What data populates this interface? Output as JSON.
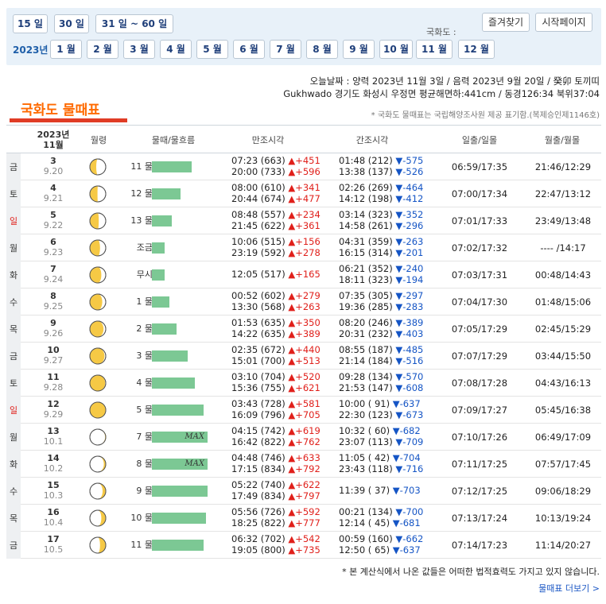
{
  "top_row_buttons": [
    "15 일",
    "30 일",
    "31 일 ~ 60 일"
  ],
  "kw_label": "국화도 :",
  "bookmark_btn": "즐겨찾기",
  "homepage_btn": "시작페이지",
  "year_label": "2023년",
  "months": [
    "1 월",
    "2 월",
    "3 월",
    "4 월",
    "5 월",
    "6 월",
    "7 월",
    "8 월",
    "9 월",
    "10 월",
    "11 월",
    "12 월"
  ],
  "today_line1": "오늘날짜 : 양력 2023년 11월 3일 / 음력 2023년 9월 20일 / 癸卯 토끼띠",
  "today_line2": "Gukhwado 경기도 화성시 우정면 평균해면하:441cm / 동경126:34 북위37:04",
  "page_title": "국화도 물때표",
  "source_note": "* 국화도 물때표는 국립해양조사원 제공 표기함.(복제승인제1146호)",
  "header": {
    "date_year": "2023년",
    "date_month": "11월",
    "moon": "월령",
    "tide": "물때/물흐름",
    "high": "만조시각",
    "low": "간조시각",
    "sun": "일출/일몰",
    "moonrise": "월출/월몰"
  },
  "rows": [
    {
      "wd": "금",
      "date": "3",
      "lunar": "9.20",
      "tide": "11 물",
      "bar": 0.56,
      "max": "",
      "high1": "07:23 (663)",
      "hd1": "▲+451",
      "high2": "20:00 (733)",
      "hd2": "▲+596",
      "low1": "01:48 (212)",
      "ld1": "▼-575",
      "low2": "13:38 (137)",
      "ld2": "▼-526",
      "sun": "06:59/17:35",
      "moon": "21:46/12:29",
      "phase": 0.8
    },
    {
      "wd": "토",
      "date": "4",
      "lunar": "9.21",
      "tide": "12 물",
      "bar": 0.4,
      "max": "",
      "high1": "08:00 (610)",
      "hd1": "▲+341",
      "high2": "20:44 (674)",
      "hd2": "▲+477",
      "low1": "02:26 (269)",
      "ld1": "▼-464",
      "low2": "14:12 (198)",
      "ld2": "▼-412",
      "sun": "07:00/17:34",
      "moon": "22:47/13:12",
      "phase": 0.76
    },
    {
      "wd": "일",
      "date": "5",
      "lunar": "9.22",
      "tide": "13 물",
      "bar": 0.28,
      "max": "",
      "high1": "08:48 (557)",
      "hd1": "▲+234",
      "high2": "21:45 (622)",
      "hd2": "▲+361",
      "low1": "03:14 (323)",
      "ld1": "▼-352",
      "low2": "14:58 (261)",
      "ld2": "▼-296",
      "sun": "07:01/17:33",
      "moon": "23:49/13:48",
      "phase": 0.72
    },
    {
      "wd": "월",
      "date": "6",
      "lunar": "9.23",
      "tide": "조금",
      "bar": 0.18,
      "max": "",
      "high1": "10:06 (515)",
      "hd1": "▲+156",
      "high2": "23:19 (592)",
      "hd2": "▲+278",
      "low1": "04:31 (359)",
      "ld1": "▼-263",
      "low2": "16:15 (314)",
      "ld2": "▼-201",
      "sun": "07:02/17:32",
      "moon": "---- /14:17",
      "phase": 0.68
    },
    {
      "wd": "화",
      "date": "7",
      "lunar": "9.24",
      "tide": "무시",
      "bar": 0.18,
      "max": "",
      "high1": "12:05 (517)",
      "hd1": "▲+165",
      "high2": "",
      "hd2": "",
      "low1": "06:21 (352)",
      "ld1": "▼-240",
      "low2": "18:11 (323)",
      "ld2": "▼-194",
      "sun": "07:03/17:31",
      "moon": "00:48/14:43",
      "phase": 0.64
    },
    {
      "wd": "수",
      "date": "8",
      "lunar": "9.25",
      "tide": "1 물",
      "bar": 0.24,
      "max": "",
      "high1": "00:52 (602)",
      "hd1": "▲+279",
      "high2": "13:30 (568)",
      "hd2": "▲+263",
      "low1": "07:35 (305)",
      "ld1": "▼-297",
      "low2": "19:36 (285)",
      "ld2": "▼-283",
      "sun": "07:04/17:30",
      "moon": "01:48/15:06",
      "phase": 0.61
    },
    {
      "wd": "목",
      "date": "9",
      "lunar": "9.26",
      "tide": "2 물",
      "bar": 0.34,
      "max": "",
      "high1": "01:53 (635)",
      "hd1": "▲+350",
      "high2": "14:22 (635)",
      "hd2": "▲+389",
      "low1": "08:20 (246)",
      "ld1": "▼-389",
      "low2": "20:31 (232)",
      "ld2": "▼-403",
      "sun": "07:05/17:29",
      "moon": "02:45/15:29",
      "phase": 0.57
    },
    {
      "wd": "금",
      "date": "10",
      "lunar": "9.27",
      "tide": "3 물",
      "bar": 0.5,
      "max": "",
      "high1": "02:35 (672)",
      "hd1": "▲+440",
      "high2": "15:01 (700)",
      "hd2": "▲+513",
      "low1": "08:55 (187)",
      "ld1": "▼-485",
      "low2": "21:14 (184)",
      "ld2": "▼-516",
      "sun": "07:07/17:29",
      "moon": "03:44/15:50",
      "phase": 0.54
    },
    {
      "wd": "토",
      "date": "11",
      "lunar": "9.28",
      "tide": "4 물",
      "bar": 0.6,
      "max": "",
      "high1": "03:10 (704)",
      "hd1": "▲+520",
      "high2": "15:36 (755)",
      "hd2": "▲+621",
      "low1": "09:28 (134)",
      "ld1": "▼-570",
      "low2": "21:53 (147)",
      "ld2": "▼-608",
      "sun": "07:08/17:28",
      "moon": "04:43/16:13",
      "phase": 0.52
    },
    {
      "wd": "일",
      "date": "12",
      "lunar": "9.29",
      "tide": "5 물",
      "bar": 0.72,
      "max": "",
      "high1": "03:43 (728)",
      "hd1": "▲+581",
      "high2": "16:09 (796)",
      "hd2": "▲+705",
      "low1": "10:00 ( 91)",
      "ld1": "▼-637",
      "low2": "22:30 (123)",
      "ld2": "▼-673",
      "sun": "07:09/17:27",
      "moon": "05:45/16:38",
      "phase": 0.5
    },
    {
      "wd": "월",
      "date": "13",
      "lunar": "10.1",
      "tide": "7 물",
      "bar": 0.78,
      "max": "MAX",
      "high1": "04:15 (742)",
      "hd1": "▲+619",
      "high2": "16:42 (822)",
      "hd2": "▲+762",
      "low1": "10:32 ( 60)",
      "ld1": "▼-682",
      "low2": "23:07 (113)",
      "ld2": "▼-709",
      "sun": "07:10/17:26",
      "moon": "06:49/17:09",
      "phase": 0.02
    },
    {
      "wd": "화",
      "date": "14",
      "lunar": "10.2",
      "tide": "8 물",
      "bar": 0.78,
      "max": "MAX",
      "high1": "04:48 (746)",
      "hd1": "▲+633",
      "high2": "17:15 (834)",
      "hd2": "▲+792",
      "low1": "11:05 ( 42)",
      "ld1": "▼-704",
      "low2": "23:43 (118)",
      "ld2": "▼-716",
      "sun": "07:11/17:25",
      "moon": "07:57/17:45",
      "phase": 0.06
    },
    {
      "wd": "수",
      "date": "15",
      "lunar": "10.3",
      "tide": "9 물",
      "bar": 0.78,
      "max": "",
      "high1": "05:22 (740)",
      "hd1": "▲+622",
      "high2": "17:49 (834)",
      "hd2": "▲+797",
      "low1": "11:39 ( 37)",
      "ld1": "▼-703",
      "low2": "",
      "ld2": "",
      "sun": "07:12/17:25",
      "moon": "09:06/18:29",
      "phase": 0.1
    },
    {
      "wd": "목",
      "date": "16",
      "lunar": "10.4",
      "tide": "10 물",
      "bar": 0.76,
      "max": "",
      "high1": "05:56 (726)",
      "hd1": "▲+592",
      "high2": "18:25 (822)",
      "hd2": "▲+777",
      "low1": "00:21 (134)",
      "ld1": "▼-700",
      "low2": "12:14 ( 45)",
      "ld2": "▼-681",
      "sun": "07:13/17:24",
      "moon": "10:13/19:24",
      "phase": 0.14
    },
    {
      "wd": "금",
      "date": "17",
      "lunar": "10.5",
      "tide": "11 물",
      "bar": 0.72,
      "max": "",
      "high1": "06:32 (702)",
      "hd1": "▲+542",
      "high2": "19:05 (800)",
      "hd2": "▲+735",
      "low1": "00:59 (160)",
      "ld1": "▼-662",
      "low2": "12:50 ( 65)",
      "ld2": "▼-637",
      "sun": "07:14/17:23",
      "moon": "11:14/20:27",
      "phase": 0.18
    }
  ],
  "footnote": "* 본 계산식에서 나온 값들은 어떠한 법적효력도 가지고 있지 않습니다.",
  "more_link": "물때표 더보기 >",
  "colors": {
    "bar": "#7cc894",
    "up": "#e0201b",
    "down": "#1555c5",
    "title": "#ff6a00",
    "moon": "#f6c945"
  }
}
